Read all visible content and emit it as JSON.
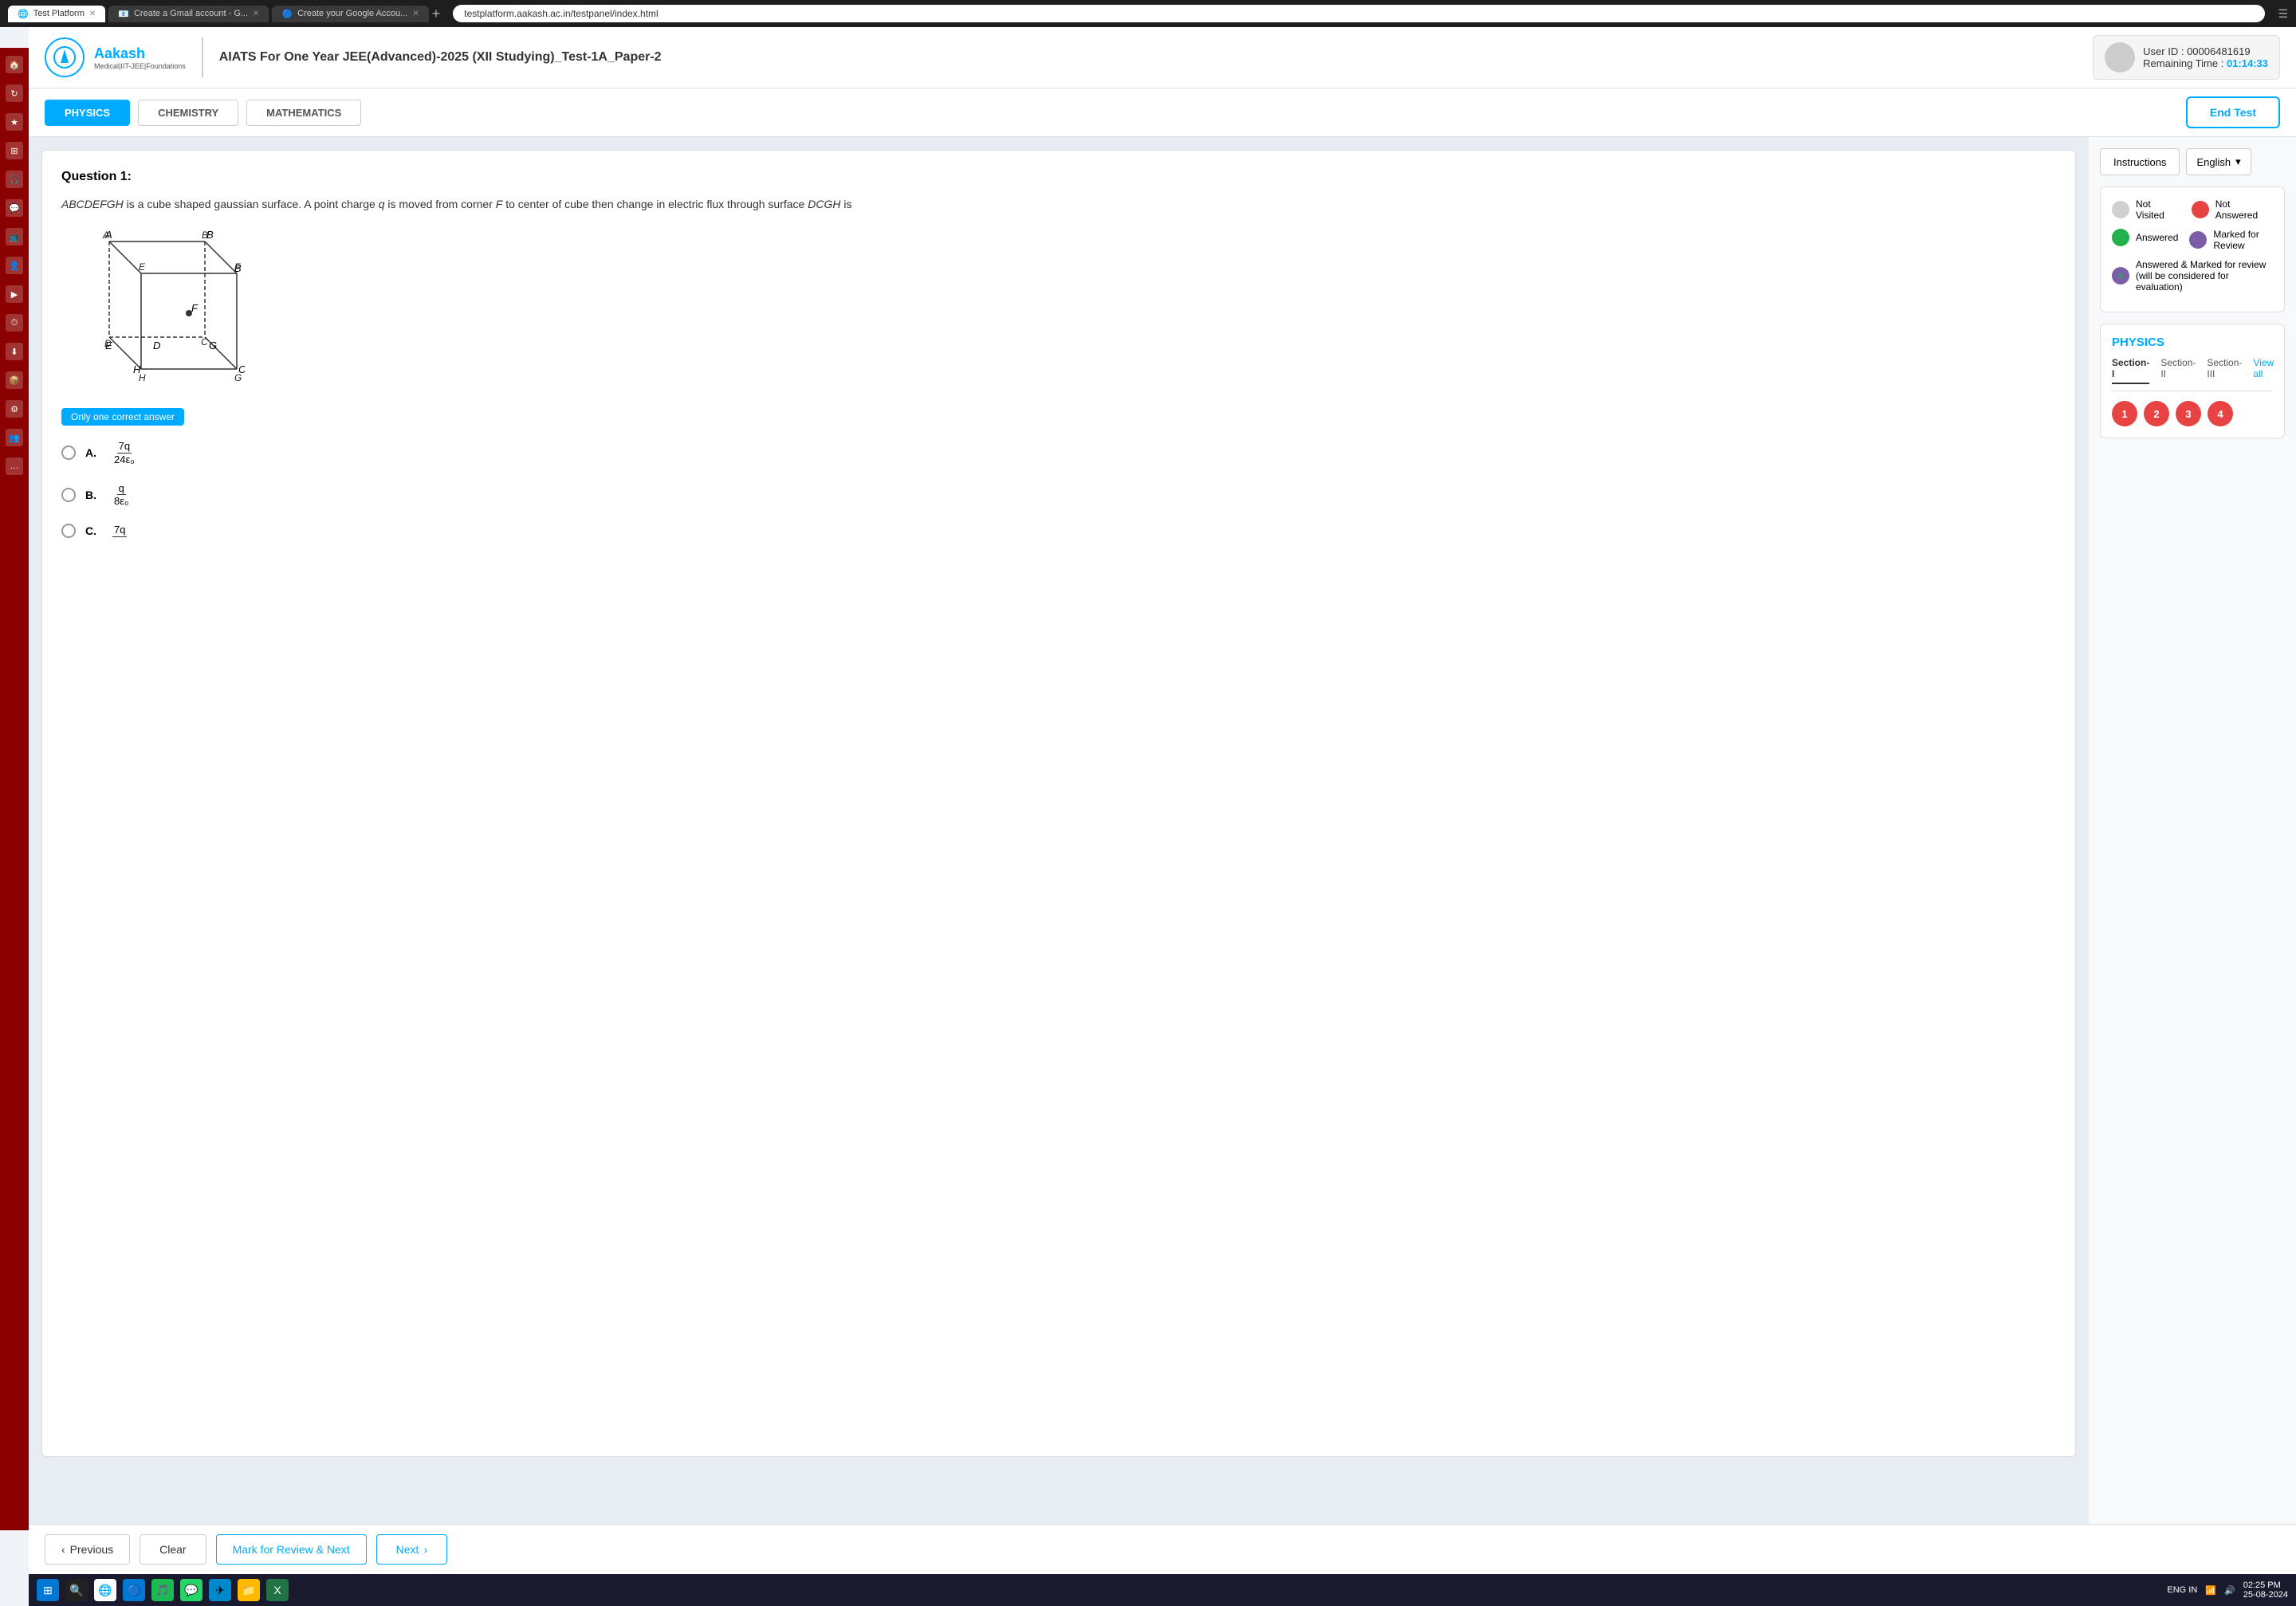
{
  "browser": {
    "tabs": [
      {
        "label": "Test Platform",
        "active": true,
        "favicon": "🌐"
      },
      {
        "label": "Create a Gmail account - G...",
        "active": false,
        "favicon": "📧"
      },
      {
        "label": "Create your Google Accou...",
        "active": false,
        "favicon": "🔵"
      }
    ],
    "address": "testplatform.aakash.ac.in/testpanel/index.html"
  },
  "header": {
    "logo_text": "Aakash",
    "logo_sub": "Medical|IIT-JEE|Foundations",
    "exam_title": "AIATS For One Year JEE(Advanced)-2025 (XII Studying)_Test-1A_Paper-2",
    "user_id_label": "User ID",
    "user_id_value": ": 00006481619",
    "remaining_time_label": "Remaining Time",
    "remaining_time_value": "01:14:33"
  },
  "subject_tabs": [
    {
      "label": "PHYSICS",
      "active": true
    },
    {
      "label": "CHEMISTRY",
      "active": false
    },
    {
      "label": "MATHEMATICS",
      "active": false
    }
  ],
  "end_test_btn": "End Test",
  "question": {
    "number": "Question 1:",
    "text": "ABCDEFGH is a cube shaped gaussian surface. A point charge q is moved from corner F to center of cube then change in electric flux through surface DCGH is",
    "answer_type": "Only one correct answer",
    "options": [
      {
        "label": "A.",
        "numerator": "7q",
        "denominator": "24ε₀"
      },
      {
        "label": "B.",
        "numerator": "q",
        "denominator": "8ε₀"
      },
      {
        "label": "C.",
        "numerator": "7q",
        "denominator": ""
      }
    ]
  },
  "right_panel": {
    "instructions_btn": "Instructions",
    "language_btn": "English",
    "legend": {
      "items": [
        {
          "label": "Not Visited",
          "color": "gray"
        },
        {
          "label": "Not Answered",
          "color": "red"
        },
        {
          "label": "Answered",
          "color": "green"
        },
        {
          "label": "Marked for Review",
          "color": "purple"
        },
        {
          "label": "Answered & Marked for review (will be considered for evaluation)",
          "color": "purple-b"
        }
      ]
    },
    "section_title": "PHYSICS",
    "section_tabs": [
      {
        "label": "Section-I",
        "active": true
      },
      {
        "label": "Section-II",
        "active": false
      },
      {
        "label": "Section-III",
        "active": false
      }
    ],
    "view_all": "View all",
    "question_numbers": [
      "1",
      "2",
      "3",
      "4"
    ]
  },
  "bottom_bar": {
    "prev_label": "Previous",
    "clear_label": "Clear",
    "mark_label": "Mark for Review & Next",
    "next_label": "Next"
  },
  "taskbar": {
    "time": "02:25 PM",
    "date": "25-08-2024",
    "lang": "ENG IN"
  }
}
